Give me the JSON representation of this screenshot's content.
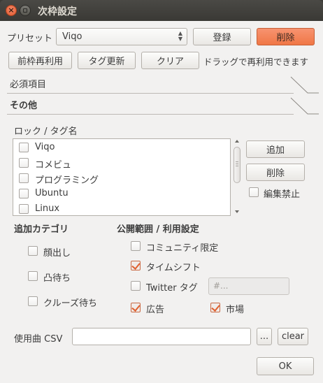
{
  "window": {
    "title": "次枠設定"
  },
  "preset": {
    "label": "プリセット",
    "value": "Viqo",
    "register_label": "登録",
    "delete_label": "削除"
  },
  "toolbar": {
    "reuse_label": "前枠再利用",
    "tag_update_label": "タグ更新",
    "clear_label": "クリア",
    "drag_hint": "ドラッグで再利用できます"
  },
  "sections": {
    "required": "必須項目",
    "other": "その他"
  },
  "tags": {
    "label": "ロック / タグ名",
    "items": [
      {
        "label": "Viqo",
        "checked": false
      },
      {
        "label": "コメビュ",
        "checked": false
      },
      {
        "label": "プログラミング",
        "checked": false
      },
      {
        "label": "Ubuntu",
        "checked": false
      },
      {
        "label": "Linux",
        "checked": false
      }
    ],
    "add_label": "追加",
    "delete_label": "削除",
    "lock_edit_label": "編集禁止",
    "lock_edit_checked": false
  },
  "category": {
    "title": "追加カテゴリ",
    "items": [
      {
        "label": "顔出し",
        "checked": false
      },
      {
        "label": "凸待ち",
        "checked": false
      },
      {
        "label": "クルーズ待ち",
        "checked": false
      }
    ]
  },
  "publish": {
    "title": "公開範囲 / 利用設定",
    "community_only": {
      "label": "コミュニティ限定",
      "checked": false
    },
    "timeshift": {
      "label": "タイムシフト",
      "checked": true
    },
    "twitter": {
      "label": "Twitter タグ",
      "checked": false,
      "placeholder": "#..."
    },
    "ads": {
      "label": "広告",
      "checked": true
    },
    "market": {
      "label": "市場",
      "checked": true
    }
  },
  "csv": {
    "label": "使用曲 CSV",
    "value": "",
    "browse_label": "...",
    "clear_label": "clear"
  },
  "ok_label": "OK",
  "colors": {
    "accent": "#f07746",
    "titlebar": "#3c3b37",
    "background": "#f2f1f0",
    "check": "#e0602f"
  }
}
